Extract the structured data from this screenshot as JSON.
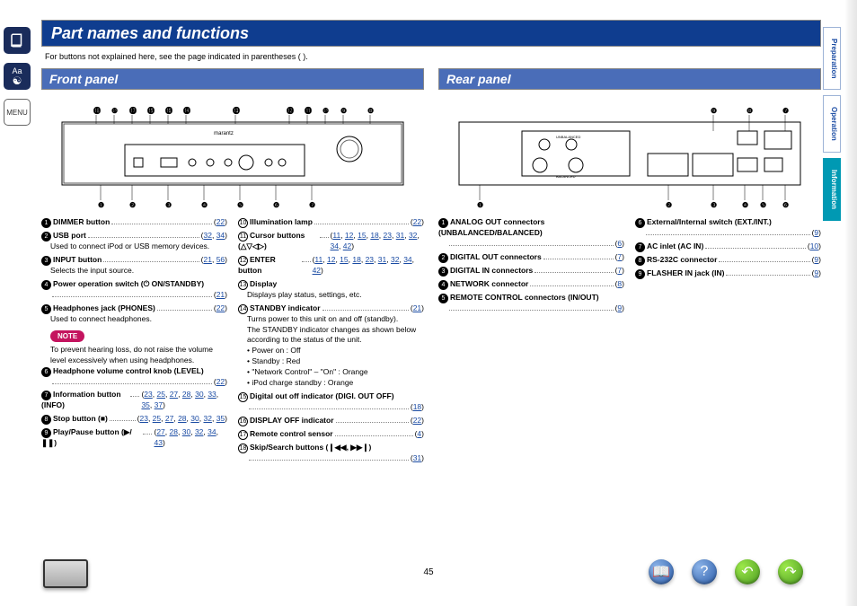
{
  "page_title": "Part names and functions",
  "subtitle": "For buttons not explained here, see the page indicated in parentheses (  ).",
  "page_number": "45",
  "tabs": {
    "prep": "Preparation",
    "op": "Operation",
    "info": "Information"
  },
  "menu_label": "MENU",
  "sections": {
    "front": {
      "title": "Front panel",
      "col1": [
        {
          "n": "1",
          "label": "DIMMER button",
          "pages": [
            "22"
          ]
        },
        {
          "n": "2",
          "label": "USB port",
          "pages": [
            "32",
            "34"
          ],
          "desc": "Used to connect iPod or USB memory devices."
        },
        {
          "n": "3",
          "label": "INPUT button",
          "pages": [
            "21",
            "56"
          ],
          "desc": "Selects the input source."
        },
        {
          "n": "4",
          "label": "Power operation switch (⏻ ON/STANDBY)",
          "pages": [
            "21"
          ]
        },
        {
          "n": "5",
          "label": "Headphones jack (PHONES)",
          "pages": [
            "22"
          ],
          "desc": "Used to connect headphones."
        },
        {
          "note": true,
          "text": "To prevent hearing loss, do not raise the volume level excessively when using headphones."
        },
        {
          "n": "6",
          "label": "Headphone volume control knob (LEVEL)",
          "pages": [
            "22"
          ]
        },
        {
          "n": "7",
          "label": "Information button (INFO)",
          "pages": [
            "23",
            "25",
            "27",
            "28",
            "30",
            "33",
            "35",
            "37"
          ]
        },
        {
          "n": "8",
          "label": "Stop button (■)",
          "pages": [
            "23",
            "25",
            "27",
            "28",
            "30",
            "32",
            "35"
          ]
        },
        {
          "n": "9",
          "label": "Play/Pause button (▶/❚❚)",
          "pages": [
            "27",
            "28",
            "30",
            "32",
            "34",
            "43"
          ]
        }
      ],
      "col2": [
        {
          "n": "10",
          "w": true,
          "label": "Illumination lamp",
          "pages": [
            "22"
          ]
        },
        {
          "n": "11",
          "w": true,
          "label": "Cursor buttons (△▽◁▷)",
          "pages": [
            "11",
            "12",
            "15",
            "18",
            "23",
            "31",
            "32",
            "34",
            "42"
          ]
        },
        {
          "n": "12",
          "w": true,
          "label": "ENTER button",
          "pages": [
            "11",
            "12",
            "15",
            "18",
            "23",
            "31",
            "32",
            "34",
            "42"
          ]
        },
        {
          "n": "13",
          "w": true,
          "label": "Display",
          "desc": "Displays play status, settings, etc."
        },
        {
          "n": "14",
          "w": true,
          "label": "STANDBY indicator",
          "pages": [
            "21"
          ],
          "desc": "Turns power to this unit on and off (standby).",
          "extra": [
            "The STANDBY indicator changes as shown below according to the status of the unit.",
            "• Power on : Off",
            "• Standby : Red",
            "• \"Network Control\" – \"On\" : Orange",
            "• iPod charge standby : Orange"
          ]
        },
        {
          "n": "15",
          "w": true,
          "label": "Digital out off indicator (DIGI. OUT OFF)",
          "pages": [
            "18"
          ]
        },
        {
          "n": "16",
          "w": true,
          "label": "DISPLAY OFF indicator",
          "pages": [
            "22"
          ]
        },
        {
          "n": "17",
          "w": true,
          "label": "Remote control sensor",
          "pages": [
            "4"
          ]
        },
        {
          "n": "18",
          "w": true,
          "label": "Skip/Search buttons (❙◀◀, ▶▶❙)",
          "pages": [
            "31"
          ]
        }
      ]
    },
    "rear": {
      "title": "Rear panel",
      "col1": [
        {
          "n": "1",
          "label": "ANALOG OUT connectors (UNBALANCED/BALANCED)",
          "pages": [
            "6"
          ]
        },
        {
          "n": "2",
          "label": "DIGITAL OUT connectors",
          "pages": [
            "7"
          ]
        },
        {
          "n": "3",
          "label": "DIGITAL IN connectors",
          "pages": [
            "7"
          ]
        },
        {
          "n": "4",
          "label": "NETWORK connector",
          "pages": [
            "8"
          ]
        },
        {
          "n": "5",
          "label": "REMOTE CONTROL connectors (IN/OUT)",
          "pages": [
            "9"
          ]
        }
      ],
      "col2": [
        {
          "n": "6",
          "label": "External/Internal switch (EXT./INT.)",
          "pages": [
            "9"
          ]
        },
        {
          "n": "7",
          "label": "AC inlet (AC IN)",
          "pages": [
            "10"
          ]
        },
        {
          "n": "8",
          "label": "RS-232C connector",
          "pages": [
            "9"
          ]
        },
        {
          "n": "9",
          "label": "FLASHER IN jack (IN)",
          "pages": [
            "9"
          ]
        }
      ]
    }
  }
}
